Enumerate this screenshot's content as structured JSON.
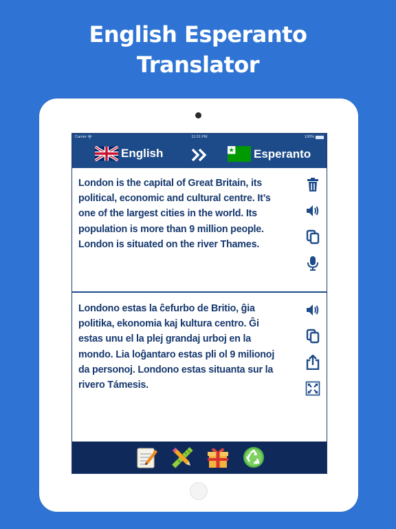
{
  "promo": {
    "title_line1": "English Esperanto",
    "title_line2": "Translator"
  },
  "status_bar": {
    "carrier": "Carrier",
    "time": "11:01 PM",
    "battery": "100%"
  },
  "languages": {
    "source": "English",
    "target": "Esperanto",
    "source_flag": "uk-flag-icon",
    "target_flag": "esperanto-flag-icon"
  },
  "input": {
    "text": "London is the capital of Great Britain, its political, economic and cultural centre. It’s one of the largest cities in the world. Its population is more than 9 million people. London is situated on the river Thames.",
    "actions": [
      "trash-icon",
      "speaker-icon",
      "copy-icon",
      "microphone-icon"
    ]
  },
  "output": {
    "text": "Londono estas la ĉefurbo de Britio, ĝia politika, ekonomia kaj kultura centro. Ĝi estas unu el la plej grandaj urboj en la mondo. Lia loĝantaro estas pli ol 9 milionoj da personoj. Londono estas situanta sur la rivero Támesis.",
    "actions": [
      "speaker-icon",
      "copy-icon",
      "share-icon",
      "fullscreen-icon"
    ]
  },
  "toolbar": {
    "items": [
      "notepad-icon",
      "pencil-ruler-icon",
      "gift-icon",
      "recycle-icon"
    ]
  },
  "colors": {
    "background": "#2f74d4",
    "header": "#1d4b89",
    "toolbar": "#0f2a5a",
    "text": "#16386e",
    "icon": "#1d4b89"
  }
}
